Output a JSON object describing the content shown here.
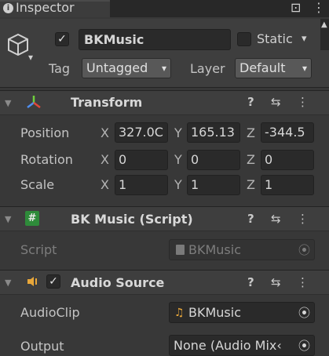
{
  "tab": {
    "title": "Inspector",
    "lock_glyph": "⊡",
    "menu_glyph": "⋮"
  },
  "object": {
    "name": "BKMusic",
    "static_label": "Static",
    "tag_label": "Tag",
    "tag_value": "Untagged",
    "layer_label": "Layer",
    "layer_value": "Default"
  },
  "transform": {
    "title": "Transform",
    "position_label": "Position",
    "rotation_label": "Rotation",
    "scale_label": "Scale",
    "axis_x": "X",
    "axis_y": "Y",
    "axis_z": "Z",
    "position": {
      "x": "327.0C",
      "y": "165.13",
      "z": "-344.5"
    },
    "rotation": {
      "x": "0",
      "y": "0",
      "z": "0"
    },
    "scale": {
      "x": "1",
      "y": "1",
      "z": "1"
    }
  },
  "script_component": {
    "title": "BK Music (Script)",
    "field_label": "Script",
    "field_value": "BKMusic"
  },
  "audio_source": {
    "title": "Audio Source",
    "clip_label": "AudioClip",
    "clip_value": "BKMusic",
    "output_label": "Output",
    "output_value": "None (Audio Mix‹"
  },
  "glyphs": {
    "help": "?",
    "preset": "⇆",
    "more": "⋮",
    "caret": "▾",
    "check": "✓",
    "target": "⦿",
    "hash": "#",
    "note": "♫"
  },
  "colors": {
    "accent_yellow": "#e8a73a",
    "script_green": "#2e8b3a"
  }
}
